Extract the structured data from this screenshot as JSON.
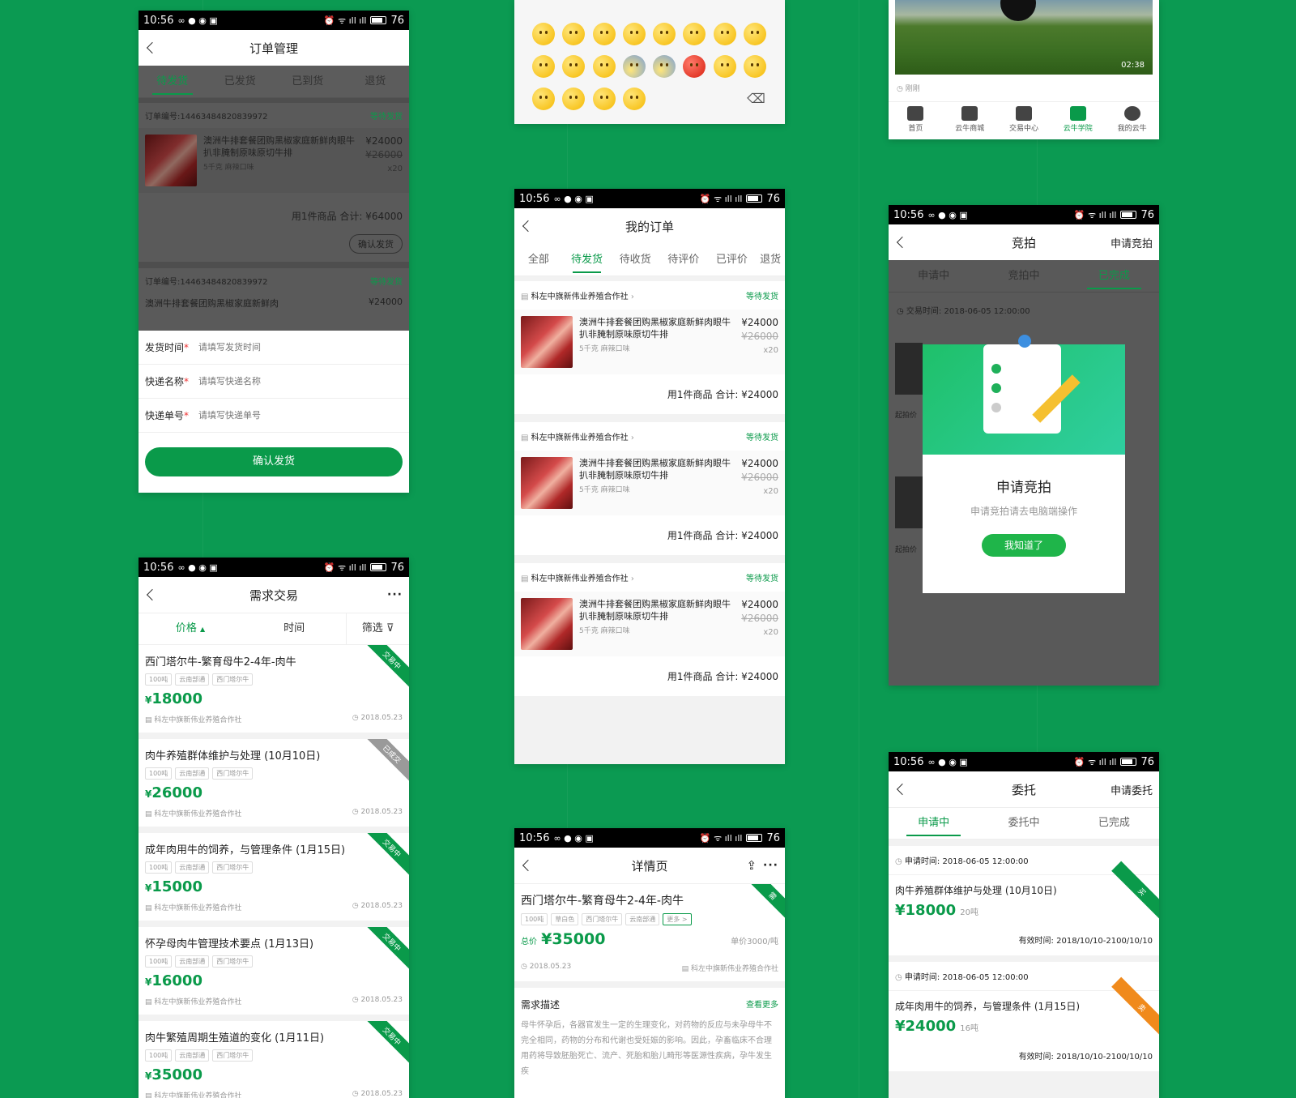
{
  "status": {
    "time": "10:56",
    "battery": "76"
  },
  "s1": {
    "title": "订单管理",
    "tabs": [
      "待发货",
      "已发货",
      "已到货",
      "退货"
    ],
    "order_no": "订单编号:1446348482083997 2",
    "order_no2": "订单编号:14463484820839972",
    "order_status": "等待发货",
    "item_title": "澳洲牛排套餐团购黑椒家庭新鲜肉眼牛扒非腌制原味原切牛排",
    "item_spec": "5千克 麻辣口味",
    "price": "¥24000",
    "old_price": "¥26000",
    "qty": "x20",
    "total": "用1件商品 合计: ¥64000",
    "confirm_small": "确认发货",
    "item2_title": "澳洲牛排套餐团购黑椒家庭新鲜肉",
    "form": [
      {
        "label": "发货时间",
        "placeholder": "请填写发货时间"
      },
      {
        "label": "快递名称",
        "placeholder": "请填写快递名称"
      },
      {
        "label": "快递单号",
        "placeholder": "请填写快递单号"
      }
    ],
    "confirm_button": "确认发货"
  },
  "s4": {
    "title": "需求交易",
    "sort": [
      "价格",
      "时间",
      "筛选"
    ],
    "items": [
      {
        "title": "西门塔尔牛-繁育母牛2-4年-肉牛",
        "price": "18000",
        "ribbon": "交易中"
      },
      {
        "title": "肉牛养殖群体维护与处理 (10月10日)",
        "price": "26000",
        "ribbon": "已成交"
      },
      {
        "title": "成年肉用牛的饲养，与管理条件 (1月15日)",
        "price": "15000",
        "ribbon": "交易中"
      },
      {
        "title": "怀孕母肉牛管理技术要点 (1月13日)",
        "price": "16000",
        "ribbon": "交易中"
      },
      {
        "title": "肉牛繁殖周期生殖道的变化 (1月11日)",
        "price": "35000",
        "ribbon": "交易中"
      }
    ],
    "tags": [
      "100吨",
      "云南部通",
      "西门塔尔牛"
    ],
    "org": "科左中旗新伟业养殖合作社",
    "date": "2018.05.23",
    "yen": "¥"
  },
  "s3": {
    "title": "我的订单",
    "tabs": [
      "全部",
      "待发货",
      "待收货",
      "待评价",
      "已评价",
      "退货"
    ],
    "shop": "科左中旗新伟业养殖合作社",
    "status": "等待发货",
    "item_title": "澳洲牛排套餐团购黑椒家庭新鲜肉眼牛扒非腌制原味原切牛排",
    "spec": "5千克 麻辣口味",
    "price": "¥24000",
    "old_price": "¥26000",
    "qty": "x20",
    "total": "用1件商品 合计: ¥24000"
  },
  "s5": {
    "title": "详情页",
    "item_title": "西门塔尔牛-繁育母牛2-4年-肉牛",
    "tags": [
      "100吨",
      "草白色",
      "西门塔尔牛",
      "云南部通",
      "更多 >"
    ],
    "total_label": "总价",
    "total_price": "¥35000",
    "unit_price": "单价3000/吨",
    "date": "2018.05.23",
    "org": "科左中旗新伟业养殖合作社",
    "desc_title": "需求描述",
    "more": "查看更多",
    "desc": "母牛怀孕后，各器官发生一定的生理变化，对药物的反应与未孕母牛不完全相同，药物的分布和代谢也受妊娠的影响。因此，孕畜临床不合理用药将导致胚胎死亡、流产、死胎和胎儿畸形等医源性疾病，孕牛发生疾"
  },
  "s6": {
    "duration": "02:38",
    "just_now": "刚刚",
    "tabs": [
      "首页",
      "云牛商城",
      "交易中心",
      "云牛学院",
      "我的云牛"
    ]
  },
  "s7": {
    "title": "竞拍",
    "right": "申请竞拍",
    "tabs": [
      "申请中",
      "竞拍中",
      "已完成"
    ],
    "trade_time": "交易时间: 2018-06-05 12:00:00",
    "start_price": "起拍价",
    "modal_title": "申请竞拍",
    "modal_desc": "申请竞拍请去电脑端操作",
    "modal_button": "我知道了"
  },
  "s8": {
    "title": "委托",
    "right": "申请委托",
    "tabs": [
      "申请中",
      "委托中",
      "已完成"
    ],
    "items": [
      {
        "time": "申请时间: 2018-06-05 12:00:00",
        "title": "肉牛养殖群体维护与处理 (10月10日)",
        "price": "¥18000",
        "unit": "20吨",
        "valid": "有效时间: 2018/10/10-2100/10/10",
        "ribbon": "买"
      },
      {
        "time": "申请时间: 2018-06-05 12:00:00",
        "title": "成年肉用牛的饲养，与管理条件 (1月15日)",
        "price": "¥24000",
        "unit": "16吨",
        "valid": "有效时间: 2018/10/10-2100/10/10",
        "ribbon": "卖"
      }
    ]
  }
}
